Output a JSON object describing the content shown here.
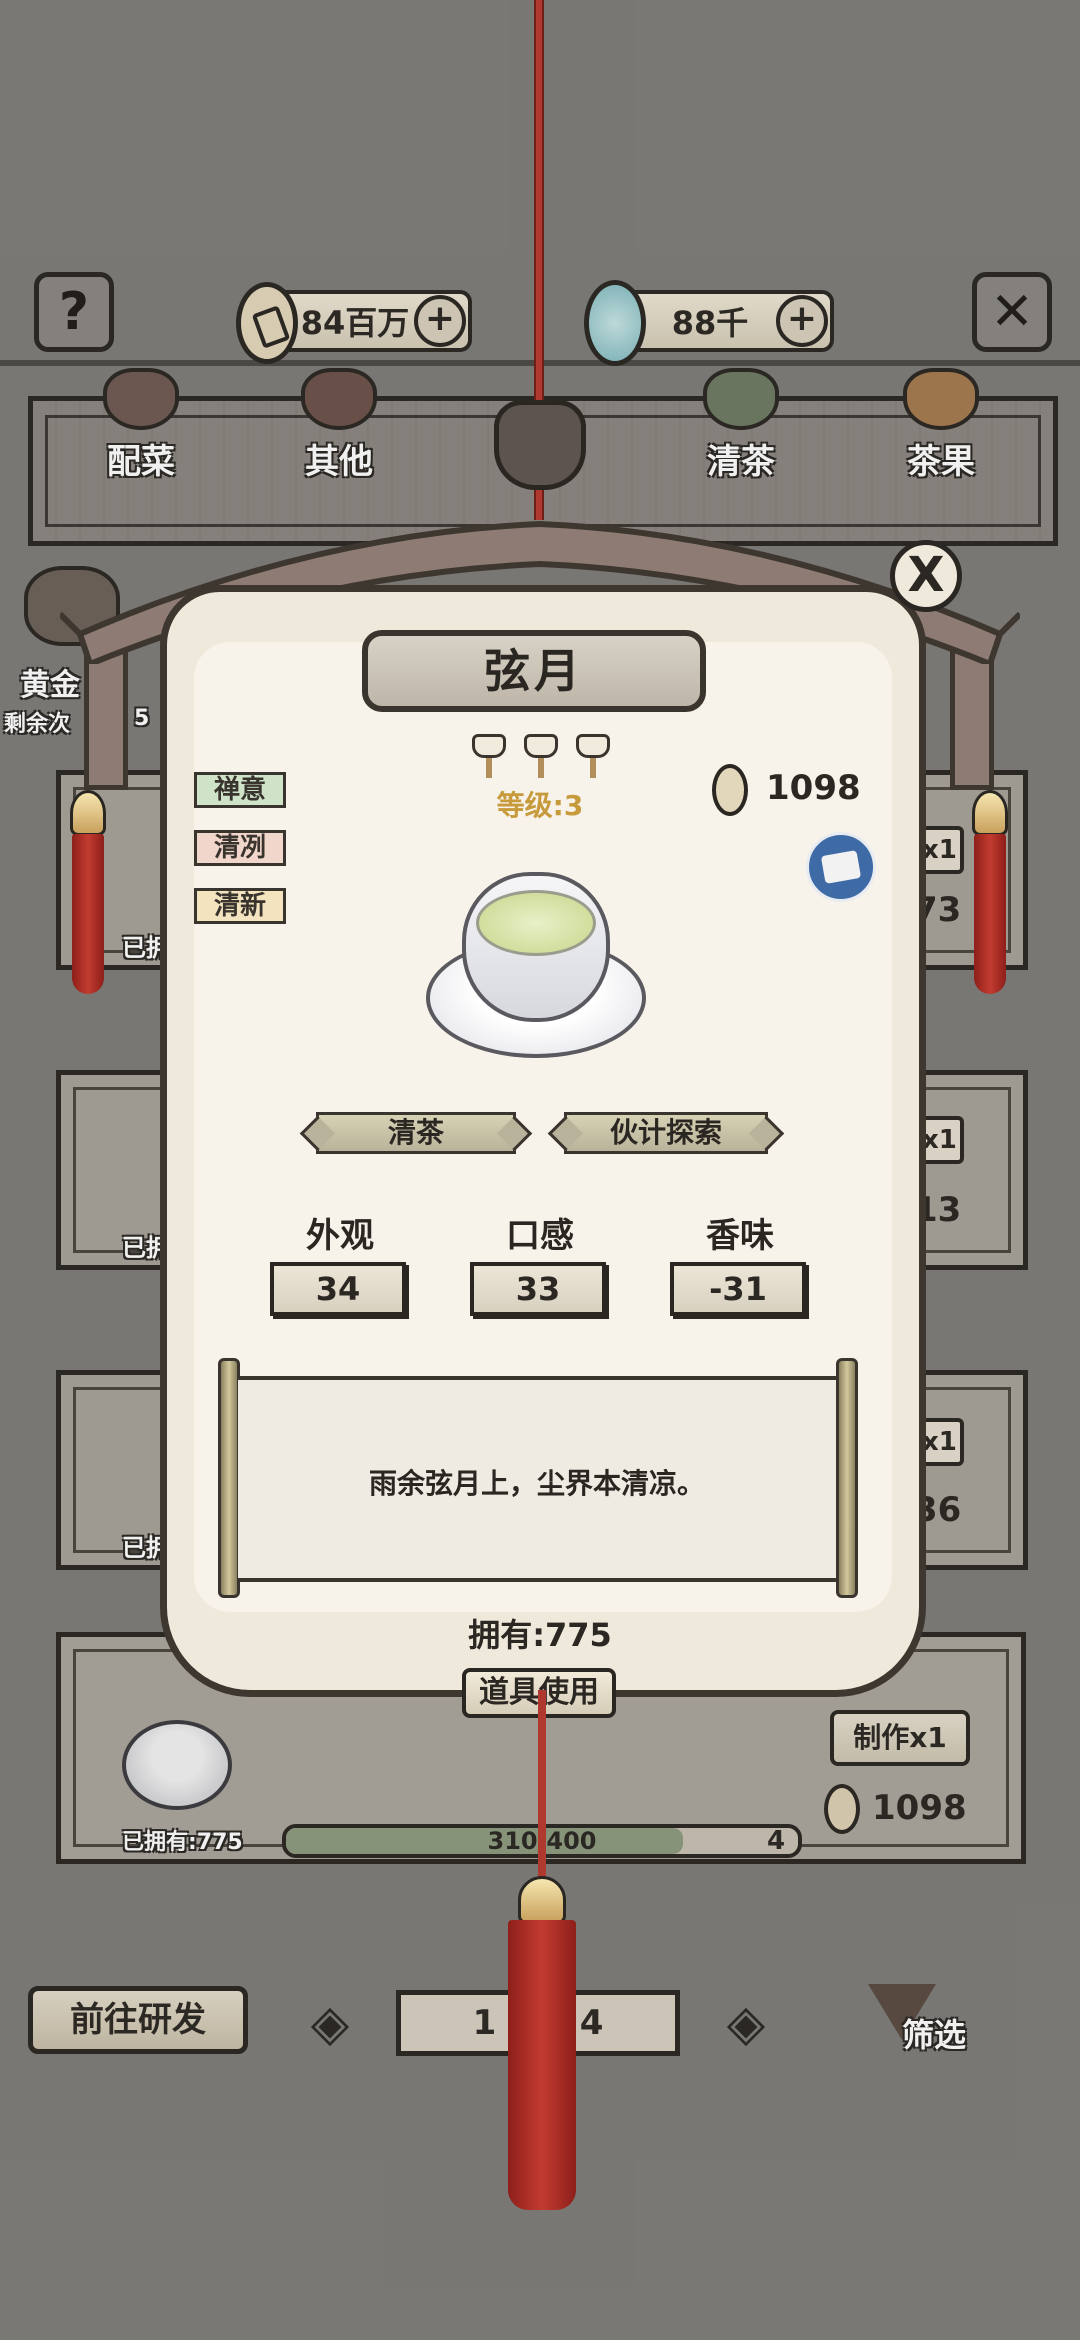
{
  "header": {
    "help_icon": "question-icon",
    "close_icon": "close-icon",
    "copper": {
      "value": "84百万",
      "plus": "+"
    },
    "jade": {
      "value": "88千",
      "plus": "+"
    }
  },
  "categories": [
    {
      "label": "配菜"
    },
    {
      "label": "其他"
    },
    {
      "label": "清茶"
    },
    {
      "label": "茶果"
    }
  ],
  "background_list": {
    "left_item_label": "黄金",
    "left_item_sub": "剩余次",
    "left_item_num": "5",
    "owned_prefix": "已拥",
    "right_counts": [
      "73",
      "13",
      "36"
    ],
    "right_multipliers": [
      "x1",
      "x1",
      "x1"
    ],
    "bottom_card": {
      "owned": "已拥有:775",
      "make_button": "制作x1",
      "price": "1098",
      "progress_text": "310/400",
      "progress_fraction": 0.775,
      "level_start": "3",
      "level_end": "4"
    }
  },
  "bottom_nav": {
    "research_button": "前往研发",
    "page_current": "1",
    "page_total": "4",
    "filter_label": "筛选"
  },
  "modal": {
    "title": "弦月",
    "level": "等级:3",
    "price": "1098",
    "tags": [
      "禅意",
      "清冽",
      "清新"
    ],
    "category_button": "清茶",
    "source_button": "伙计探索",
    "stats": [
      {
        "label": "外观",
        "value": "34"
      },
      {
        "label": "口感",
        "value": "33"
      },
      {
        "label": "香味",
        "value": "-31"
      }
    ],
    "poem": "雨余弦月上，尘界本清凉。",
    "owned": "拥有:775",
    "use_button": "道具使用",
    "close": "X"
  }
}
